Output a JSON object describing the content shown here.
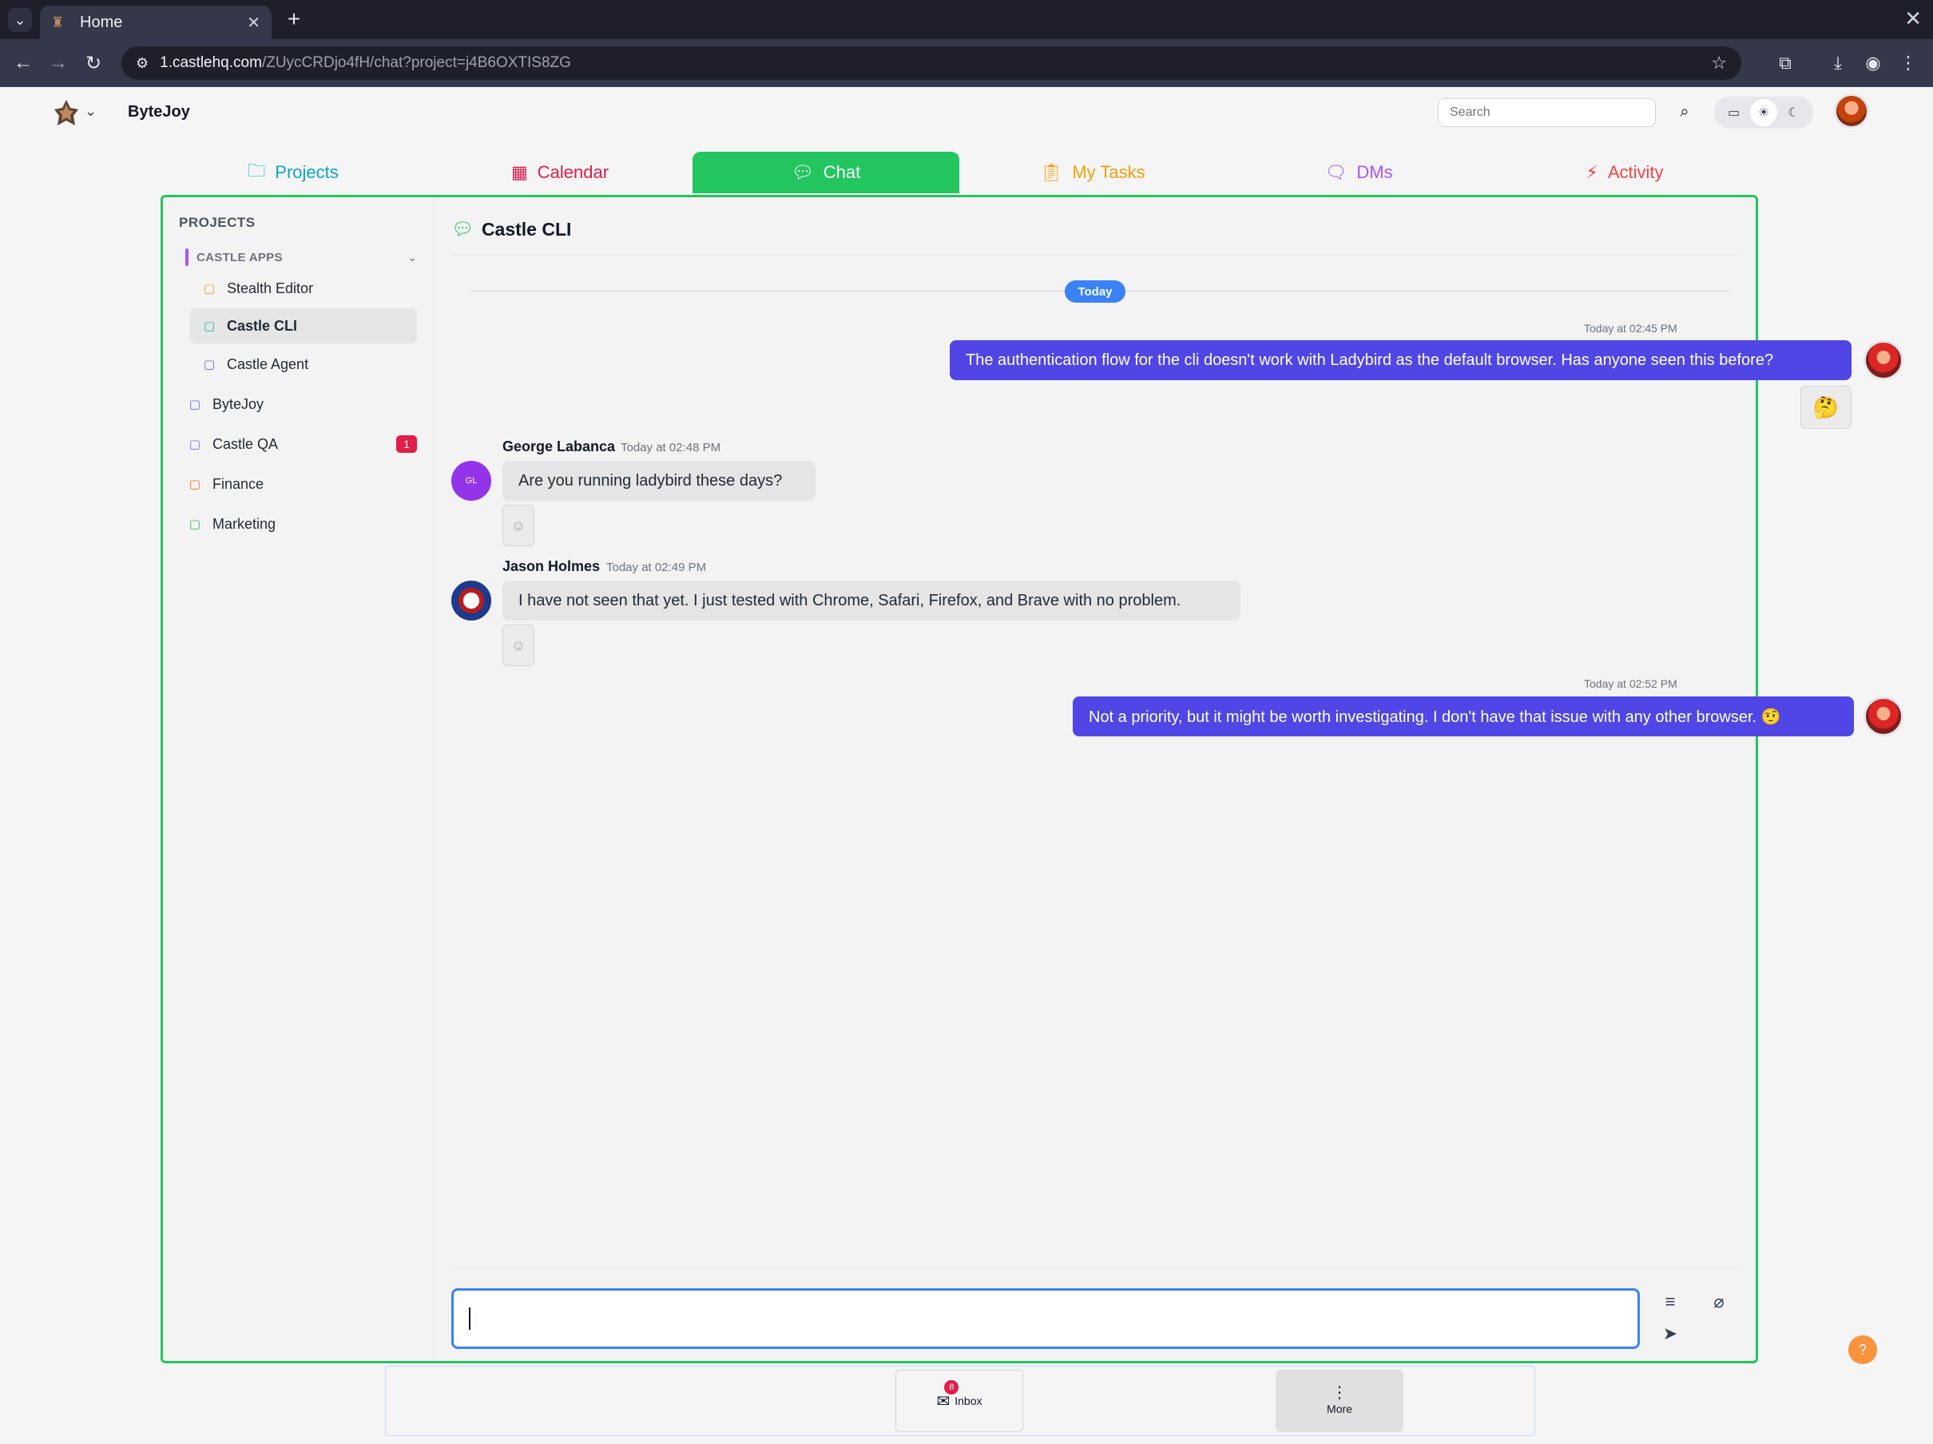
{
  "browser": {
    "tab_title": "Home",
    "url_host": "1.castlehq.com",
    "url_path": "/ZUycCRDjo4fH/chat?project=j4B6OXTIS8ZG"
  },
  "header": {
    "workspace_name": "ByteJoy",
    "search_placeholder": "Search"
  },
  "nav": {
    "projects": "Projects",
    "calendar": "Calendar",
    "chat": "Chat",
    "my_tasks": "My Tasks",
    "dms": "DMs",
    "activity": "Activity"
  },
  "sidebar": {
    "heading": "PROJECTS",
    "group": {
      "label": "CASTLE APPS",
      "items": [
        {
          "label": "Stealth Editor",
          "icon_color": "#f59e0b"
        },
        {
          "label": "Castle CLI",
          "icon_color": "#14b8a6",
          "selected": true
        },
        {
          "label": "Castle Agent",
          "icon_color": "#6366f1"
        }
      ]
    },
    "projects": [
      {
        "label": "ByteJoy",
        "icon_color": "#6366f1"
      },
      {
        "label": "Castle QA",
        "icon_color": "#8b5cf6",
        "unread": "1"
      },
      {
        "label": "Finance",
        "icon_color": "#f97316"
      },
      {
        "label": "Marketing",
        "icon_color": "#22c55e"
      }
    ]
  },
  "chat": {
    "title": "Castle CLI",
    "day_label": "Today",
    "messages": [
      {
        "sender": "",
        "time": "Today at 02:45 PM",
        "text": "The authentication flow for the cli doesn't work with Ladybird as the default browser. Has anyone seen this before?",
        "reaction": "🤔",
        "mine": true
      },
      {
        "sender": "George Labanca",
        "initials": "GL",
        "time": "Today at 02:48 PM",
        "text": "Are you running ladybird these days?"
      },
      {
        "sender": "Jason Holmes",
        "time": "Today at 02:49 PM",
        "text": "I have not seen that yet. I just tested with Chrome, Safari, Firefox, and Brave with no problem."
      },
      {
        "sender": "",
        "time": "Today at 02:52 PM",
        "text": "Not a priority, but it might be worth investigating. I don't have that issue with any other browser. 🤨",
        "mine": true
      }
    ]
  },
  "bottom": {
    "inbox_label": "Inbox",
    "inbox_count": "8",
    "more_label": "More"
  },
  "colors": {
    "accent_green": "#22c55e",
    "my_bubble": "#4f46e5",
    "today_pill": "#3b82f6"
  }
}
